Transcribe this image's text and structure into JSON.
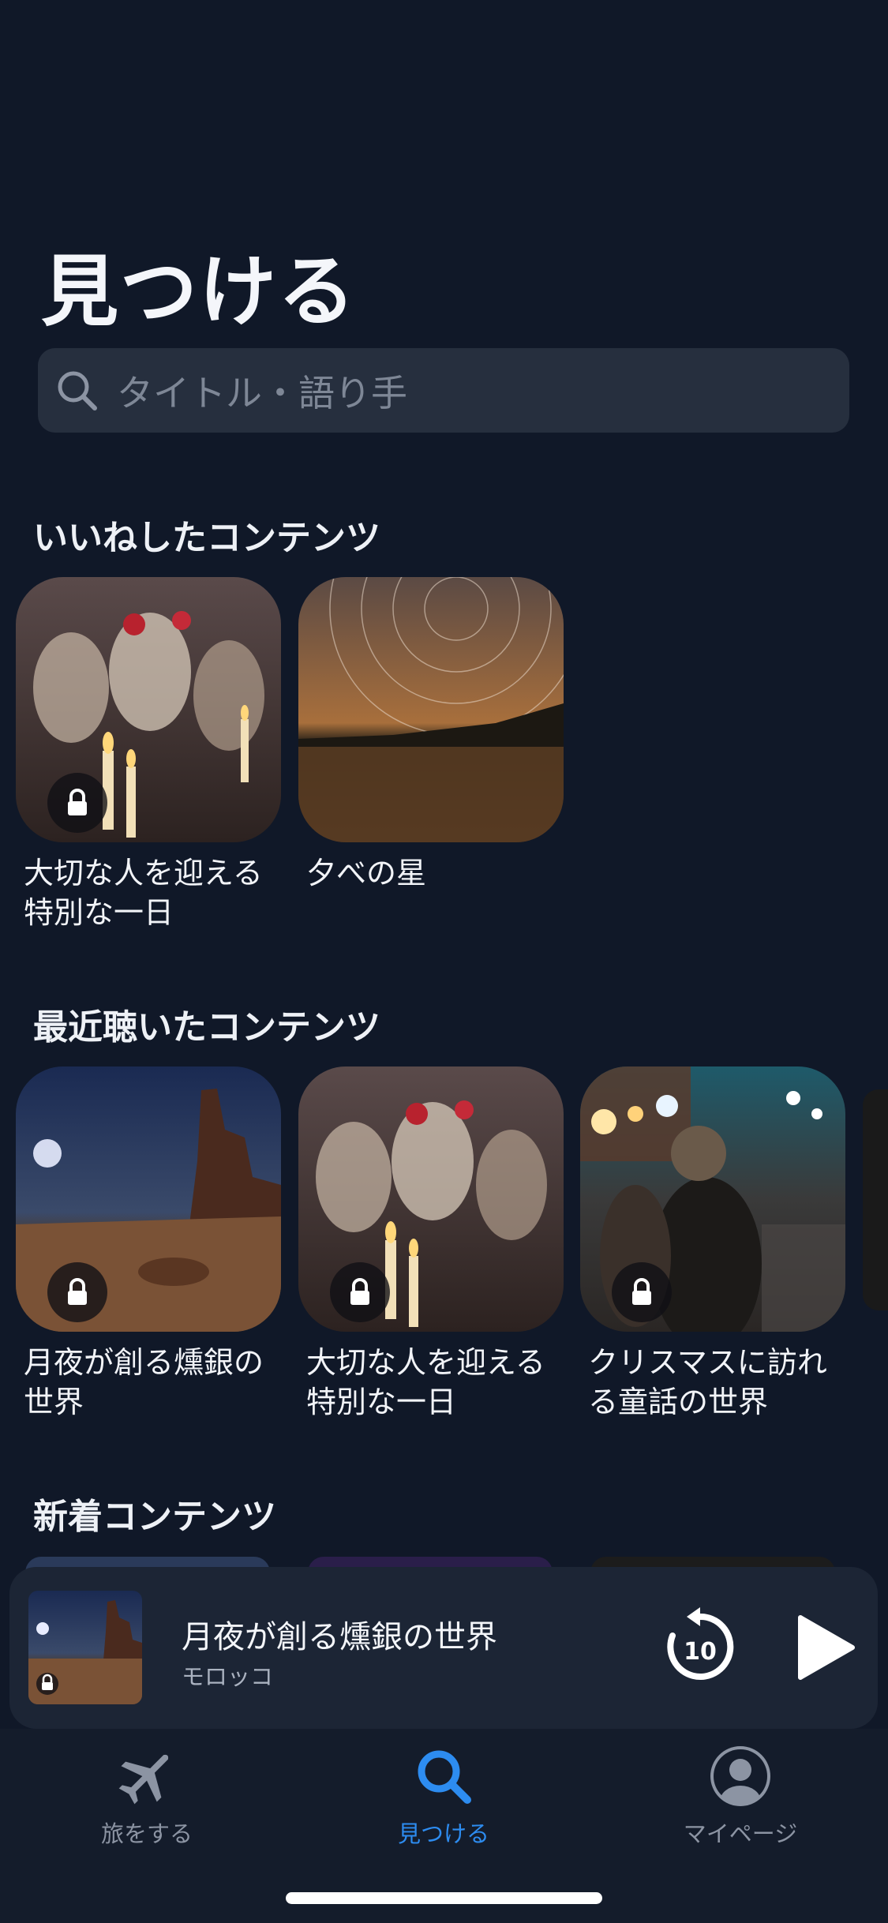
{
  "page": {
    "title": "見つける"
  },
  "search": {
    "placeholder": "タイトル・語り手"
  },
  "sections": {
    "liked": {
      "title": "いいねしたコンテンツ",
      "items": [
        {
          "title": "大切な人を迎える特別な一日",
          "locked": true
        },
        {
          "title": "夕べの星",
          "locked": false
        }
      ]
    },
    "recent": {
      "title": "最近聴いたコンテンツ",
      "items": [
        {
          "title": "月夜が創る燻銀の世界",
          "locked": true
        },
        {
          "title": "大切な人を迎える特別な一日",
          "locked": true
        },
        {
          "title": "クリスマスに訪れる童話の世界",
          "locked": true
        }
      ]
    },
    "new": {
      "title": "新着コンテンツ"
    }
  },
  "player": {
    "title": "月夜が創る燻銀の世界",
    "subtitle": "モロッコ",
    "rewind_label": "10"
  },
  "tabs": [
    {
      "label": "旅をする",
      "icon": "airplane-icon",
      "active": false
    },
    {
      "label": "見つける",
      "icon": "search-icon",
      "active": true
    },
    {
      "label": "マイページ",
      "icon": "profile-icon",
      "active": false
    }
  ],
  "colors": {
    "background": "#101828",
    "accent": "#2d8cf0",
    "inactive_tab": "#8c94a3"
  }
}
